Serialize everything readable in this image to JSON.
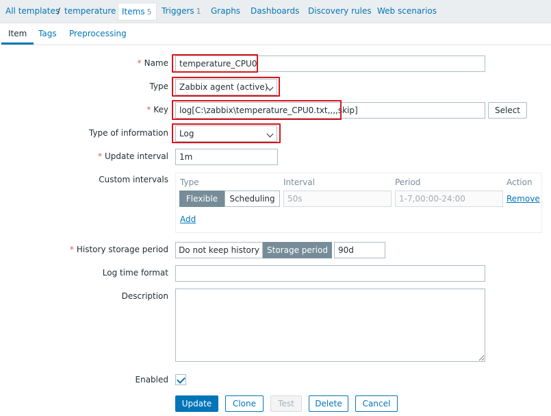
{
  "breadcrumb": {
    "all_templates": "All templates",
    "separator": "/",
    "template": "temperature"
  },
  "host_tabs": {
    "items_label": "Items",
    "items_count": "5",
    "triggers_label": "Triggers",
    "triggers_count": "1",
    "graphs": "Graphs",
    "dashboards": "Dashboards",
    "discovery_rules": "Discovery rules",
    "web_scenarios": "Web scenarios"
  },
  "form_tabs": [
    "Item",
    "Tags",
    "Preprocessing"
  ],
  "required_mark": "*",
  "form": {
    "name_label": "Name",
    "name_value": "temperature_CPU0",
    "type_label": "Type",
    "type_value": "Zabbix agent (active)",
    "key_label": "Key",
    "key_value": "log[C:\\zabbix\\temperature_CPU0.txt,,,,skip]",
    "select_button": "Select",
    "type_of_info_label": "Type of information",
    "type_of_info_value": "Log",
    "update_interval_label": "Update interval",
    "update_interval_value": "1m",
    "custom_intervals_label": "Custom intervals",
    "custom_intervals": {
      "headers": [
        "Type",
        "Interval",
        "Period",
        "Action"
      ],
      "flexible": "Flexible",
      "scheduling": "Scheduling",
      "interval_placeholder": "50s",
      "period_placeholder": "1-7,00:00-24:00",
      "remove": "Remove",
      "add": "Add"
    },
    "history_label": "History storage period",
    "history_options": [
      "Do not keep history",
      "Storage period"
    ],
    "history_value": "90d",
    "log_time_format_label": "Log time format",
    "log_time_format_value": "",
    "description_label": "Description",
    "description_value": "",
    "enabled_label": "Enabled",
    "enabled": true
  },
  "buttons": {
    "update": "Update",
    "clone": "Clone",
    "test": "Test",
    "delete": "Delete",
    "cancel": "Cancel"
  },
  "colors": {
    "link": "#0275b8",
    "highlight": "#d7151e",
    "required": "#e45959",
    "segment_active": "#768d99"
  }
}
